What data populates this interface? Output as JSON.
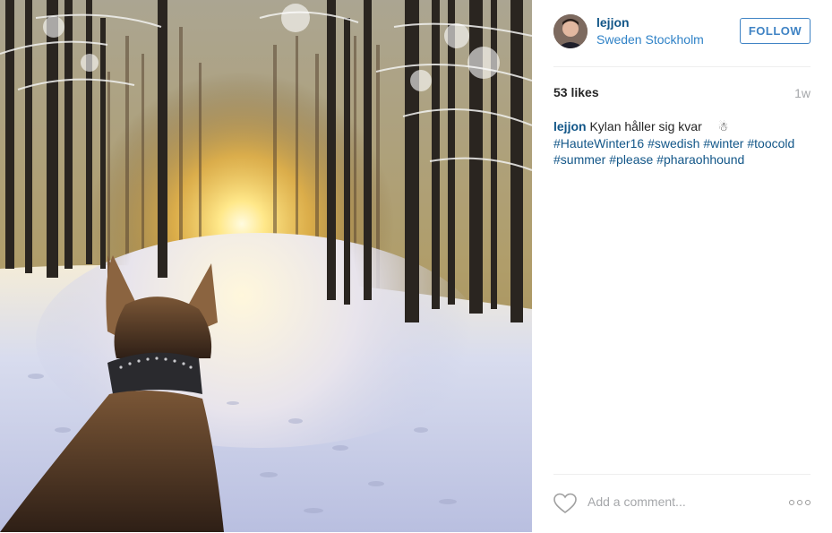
{
  "photo": {
    "alt": "",
    "colors": {
      "sky": "#f3e8c4",
      "sun": "#ffe88a",
      "snow": "#dfe3f2",
      "trees": "#2a2520",
      "dog": "#4a3426"
    }
  },
  "header": {
    "username": "lejjon",
    "location": "Sweden Stockholm",
    "follow_label": "FOLLOW",
    "avatar_icon": "avatar-photo"
  },
  "stats": {
    "likes": "53 likes",
    "timestamp": "1w"
  },
  "caption": {
    "username": "lejjon",
    "text": "Kylan håller sig kvar",
    "emoji": "☃",
    "hashtags": [
      "#HauteWinter16",
      "#swedish",
      "#winter",
      "#toocold",
      "#summer",
      "#please",
      "#pharaohhound"
    ]
  },
  "footer": {
    "comment_placeholder": "Add a comment...",
    "like_icon": "heart-icon",
    "more_icon": "more-options-icon"
  },
  "colors": {
    "link_dark": "#125688",
    "follow_blue": "#3f83c4",
    "muted": "#a5a7aa",
    "divider": "#efefef"
  }
}
